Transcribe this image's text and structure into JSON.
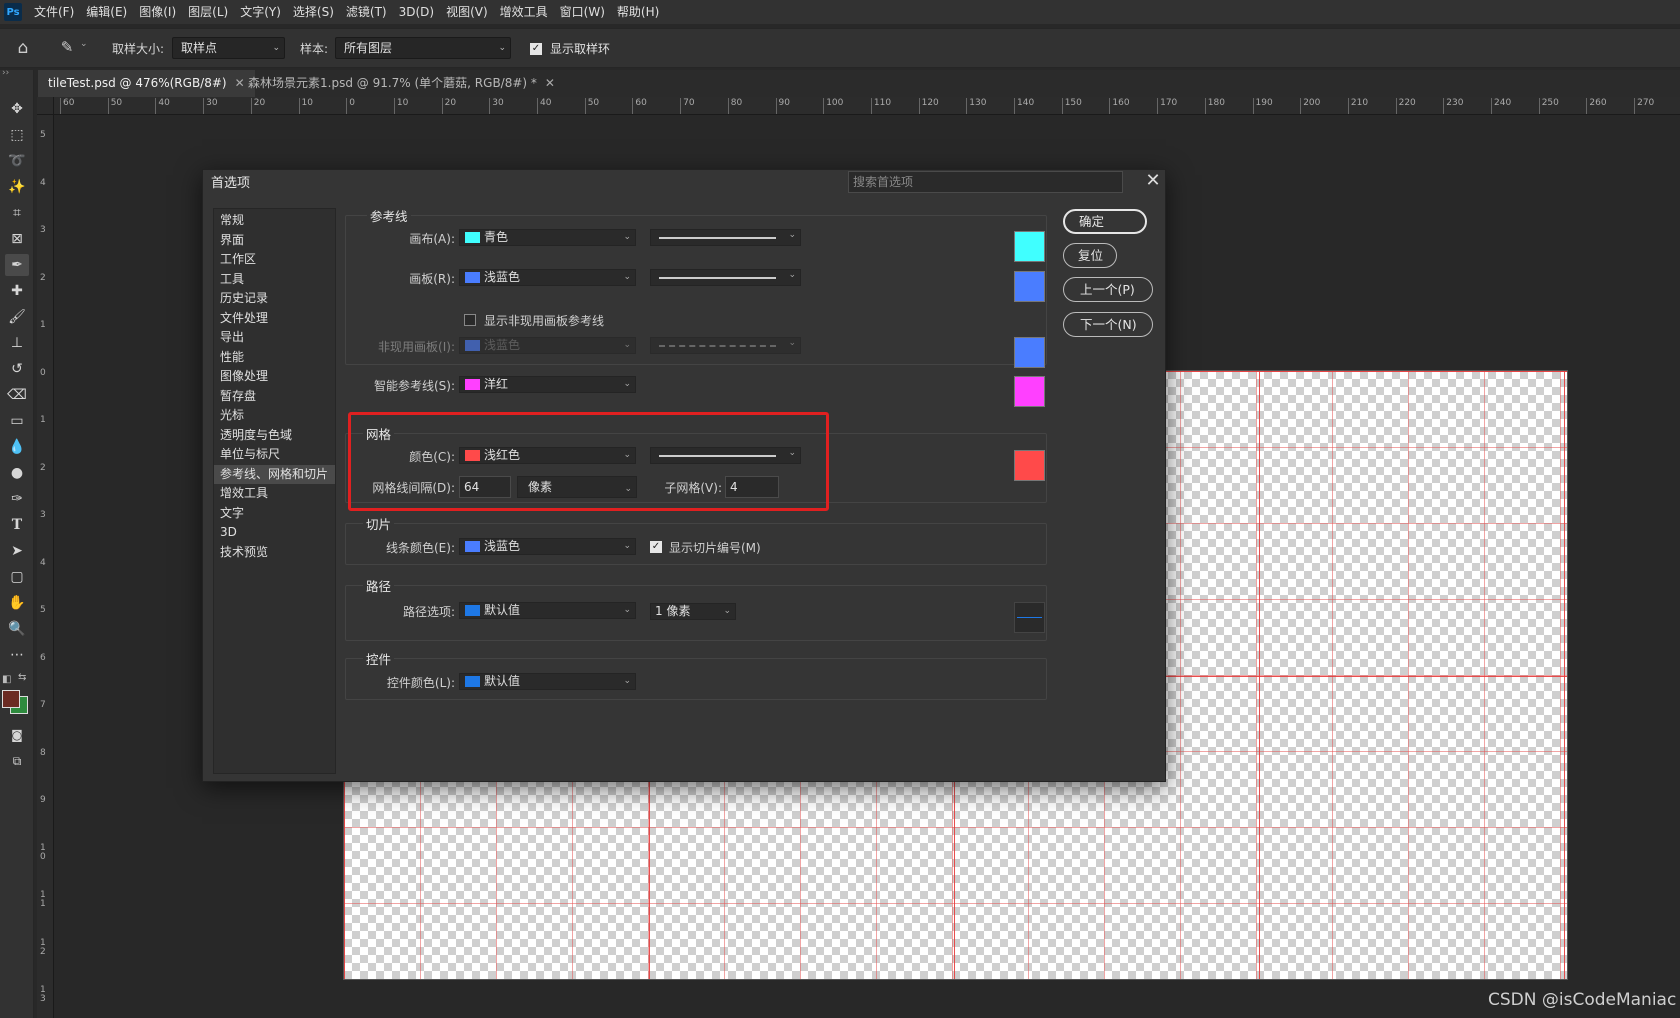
{
  "menubar": {
    "logo": "Ps",
    "items": [
      "文件(F)",
      "编辑(E)",
      "图像(I)",
      "图层(L)",
      "文字(Y)",
      "选择(S)",
      "滤镜(T)",
      "3D(D)",
      "视图(V)",
      "增效工具",
      "窗口(W)",
      "帮助(H)"
    ]
  },
  "options_bar": {
    "sample_size_label": "取样大小:",
    "sample_size_value": "取样点",
    "sample_label": "样本:",
    "sample_value": "所有图层",
    "show_ring_label": "显示取样环",
    "show_ring_checked": true
  },
  "tabs": [
    {
      "label": "tileTest.psd @ 476%(RGB/8#)",
      "active": true
    },
    {
      "label": "森林场景元素1.psd @ 91.7% (单个蘑菇, RGB/8#) *",
      "active": false
    }
  ],
  "ruler": {
    "h_ticks": [
      "60",
      "50",
      "40",
      "30",
      "20",
      "10",
      "0",
      "10",
      "20",
      "30",
      "40",
      "50",
      "60",
      "70",
      "80",
      "90",
      "100",
      "110",
      "120",
      "130",
      "140",
      "150",
      "160",
      "170",
      "180",
      "190",
      "200",
      "210",
      "220",
      "230",
      "240",
      "250",
      "260",
      "270"
    ],
    "v_ticks": [
      "5",
      "4",
      "3",
      "2",
      "1",
      "0",
      "1",
      "2",
      "3",
      "4",
      "5",
      "6",
      "7",
      "8",
      "9",
      "1 0",
      "1 1",
      "1 2",
      "1 3"
    ]
  },
  "dialog": {
    "title": "首选项",
    "search_placeholder": "搜索首选项",
    "close": "✕",
    "nav": [
      "常规",
      "界面",
      "工作区",
      "工具",
      "历史记录",
      "文件处理",
      "导出",
      "性能",
      "图像处理",
      "暂存盘",
      "光标",
      "透明度与色域",
      "单位与标尺",
      "参考线、网格和切片",
      "增效工具",
      "文字",
      "3D",
      "技术预览"
    ],
    "nav_active_index": 13,
    "buttons": {
      "ok": "确定",
      "reset": "复位",
      "prev": "上一个(P)",
      "next": "下一个(N)"
    },
    "guides": {
      "title": "参考线",
      "canvas_label": "画布(A):",
      "canvas_color_name": "青色",
      "canvas_color": "#40ffff",
      "artboard_label": "画板(R):",
      "artboard_color_name": "浅蓝色",
      "artboard_color": "#4a7dff",
      "show_inactive_label": "显示非现用画板参考线",
      "show_inactive_checked": false,
      "inactive_label": "非现用画板(I):",
      "inactive_color_name": "浅蓝色",
      "inactive_color": "#4a7dff",
      "smart_label": "智能参考线(S):",
      "smart_color_name": "洋红",
      "smart_color": "#ff40ff"
    },
    "grid": {
      "title": "网格",
      "color_label": "颜色(C):",
      "color_name": "浅红色",
      "color": "#ff4a4a",
      "spacing_label": "网格线间隔(D):",
      "spacing_value": "64",
      "unit_value": "像素",
      "subdiv_label": "子网格(V):",
      "subdiv_value": "4"
    },
    "slices": {
      "title": "切片",
      "line_color_label": "线条颜色(E):",
      "line_color_name": "浅蓝色",
      "line_color": "#4a7dff",
      "show_numbers_label": "显示切片编号(M)",
      "show_numbers_checked": true
    },
    "paths": {
      "title": "路径",
      "options_label": "路径选项:",
      "color_name": "默认值",
      "color": "#1e78e6",
      "width_value": "1 像素"
    },
    "controls": {
      "title": "控件",
      "color_label": "控件颜色(L):",
      "color_name": "默认值",
      "color": "#1e78e6"
    }
  },
  "watermark": "CSDN @isCodeManiac"
}
